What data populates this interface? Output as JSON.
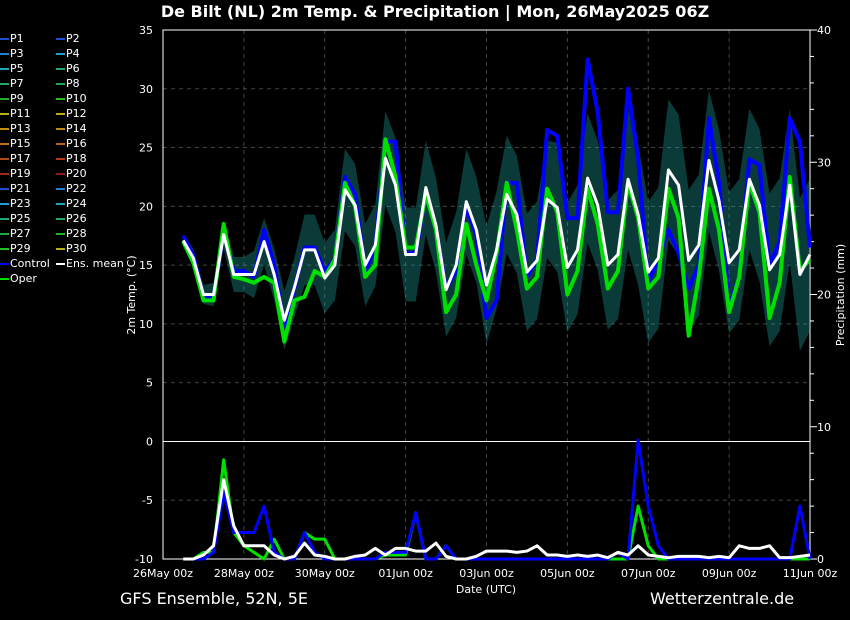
{
  "title": "De Bilt  (NL)  2m Temp. & Precipitation | Mon, 26May2025 06Z",
  "footer": {
    "left": "GFS Ensemble, 52N, 5E",
    "right": "Wetterzentrale.de"
  },
  "legend": [
    {
      "label": "P1",
      "color": "#1f4fd0"
    },
    {
      "label": "P2",
      "color": "#1f4fd0"
    },
    {
      "label": "P3",
      "color": "#1f7fd0"
    },
    {
      "label": "P4",
      "color": "#1f9fd0"
    },
    {
      "label": "P5",
      "color": "#1fa8b8"
    },
    {
      "label": "P6",
      "color": "#1fa880"
    },
    {
      "label": "P7",
      "color": "#1fa860"
    },
    {
      "label": "P8",
      "color": "#1fa850"
    },
    {
      "label": "P9",
      "color": "#20b030"
    },
    {
      "label": "P10",
      "color": "#20c020"
    },
    {
      "label": "P11",
      "color": "#b8b010"
    },
    {
      "label": "P12",
      "color": "#c0a810"
    },
    {
      "label": "P13",
      "color": "#c09010"
    },
    {
      "label": "P14",
      "color": "#c08810"
    },
    {
      "label": "P15",
      "color": "#c07010"
    },
    {
      "label": "P16",
      "color": "#b86010"
    },
    {
      "label": "P17",
      "color": "#b04a18"
    },
    {
      "label": "P18",
      "color": "#b03a18"
    },
    {
      "label": "P19",
      "color": "#a02a18"
    },
    {
      "label": "P20",
      "color": "#901818"
    },
    {
      "label": "P21",
      "color": "#1f4fd0"
    },
    {
      "label": "P22",
      "color": "#1f7fd0"
    },
    {
      "label": "P23",
      "color": "#1f9fd0"
    },
    {
      "label": "P24",
      "color": "#1fa8b8"
    },
    {
      "label": "P25",
      "color": "#1fa880"
    },
    {
      "label": "P26",
      "color": "#1fa860"
    },
    {
      "label": "P27",
      "color": "#1fa840"
    },
    {
      "label": "P28",
      "color": "#20b030"
    },
    {
      "label": "P29",
      "color": "#20c020"
    },
    {
      "label": "P30",
      "color": "#b8b010"
    },
    {
      "label": "Control",
      "color": "#0000ff"
    },
    {
      "label": "Ens. mean",
      "color": "#ffffff"
    },
    {
      "label": "Oper",
      "color": "#00e000"
    }
  ],
  "chart_data": {
    "type": "line",
    "title": "De Bilt  (NL)  2m Temp. & Precipitation | Mon, 26May2025 06Z",
    "xlabel": "Date (UTC)",
    "ylabel": "2m Temp. (°C)",
    "y2label": "Precipitation (mm)",
    "x_start": "26May2025 12Z",
    "x_step_hours": 6,
    "xlim": [
      "26May 00z",
      "11Jun 00z"
    ],
    "xticks": [
      "26May 00z",
      "28May 00z",
      "30May 00z",
      "01Jun 00z",
      "03Jun 00z",
      "05Jun 00z",
      "07Jun 00z",
      "09Jun 00z",
      "11Jun 00z"
    ],
    "ylim": [
      -10,
      35
    ],
    "yticks": [
      "-10",
      "-5",
      "0",
      "5",
      "10",
      "15",
      "20",
      "25",
      "30",
      "35"
    ],
    "y2lim": [
      0,
      40
    ],
    "y2ticks": [
      "0",
      "10",
      "20",
      "30",
      "40"
    ],
    "grid": true,
    "legend_position": "left",
    "temperature": {
      "ens_mean": [
        17.1,
        15.6,
        12.5,
        12.5,
        17.6,
        14.2,
        14.2,
        14.2,
        17.0,
        14.2,
        10.3,
        13.1,
        16.3,
        16.3,
        13.9,
        15.0,
        21.4,
        20.1,
        15.0,
        16.7,
        24.1,
        21.8,
        15.9,
        15.9,
        21.6,
        18.4,
        12.9,
        15.0,
        20.4,
        18.0,
        13.3,
        16.3,
        21.0,
        19.3,
        14.4,
        15.4,
        20.6,
        19.9,
        14.8,
        16.3,
        22.4,
        20.1,
        15.0,
        15.9,
        22.3,
        19.3,
        14.4,
        15.6,
        23.1,
        21.8,
        15.4,
        16.7,
        23.9,
        20.5,
        15.2,
        16.3,
        22.3,
        20.1,
        14.6,
        15.9,
        21.8,
        14.2,
        15.9
      ],
      "control": [
        17.5,
        15.8,
        12.3,
        12.3,
        17.8,
        14.5,
        14.5,
        14.0,
        18.0,
        15.0,
        9.8,
        13.0,
        16.5,
        16.5,
        14.5,
        15.5,
        22.5,
        21.0,
        14.5,
        16.5,
        25.5,
        25.5,
        16.0,
        16.0,
        21.0,
        18.0,
        13.0,
        14.5,
        20.0,
        17.5,
        10.5,
        12.0,
        22.0,
        22.0,
        14.0,
        15.5,
        26.5,
        26.0,
        19.0,
        19.0,
        32.5,
        28.0,
        19.5,
        19.5,
        30.0,
        24.0,
        13.5,
        15.5,
        18.0,
        16.0,
        13.0,
        15.0,
        27.5,
        22.0,
        11.5,
        14.0,
        24.0,
        23.5,
        15.0,
        17.0,
        27.5,
        25.5,
        16.5
      ],
      "oper": [
        17.0,
        15.2,
        12.0,
        12.0,
        18.5,
        14.0,
        13.8,
        13.5,
        14.0,
        13.5,
        8.5,
        12.0,
        12.3,
        14.5,
        14.0,
        15.5,
        22.0,
        20.0,
        14.0,
        15.0,
        25.7,
        22.5,
        16.5,
        16.5,
        21.0,
        18.0,
        11.0,
        12.5,
        18.5,
        15.0,
        12.0,
        16.0,
        22.0,
        18.0,
        13.0,
        14.0,
        21.5,
        19.5,
        12.5,
        14.5,
        21.5,
        18.5,
        13.0,
        14.5,
        22.0,
        19.0,
        13.0,
        14.0,
        21.5,
        19.0,
        9.0,
        14.0,
        21.5,
        18.0,
        11.0,
        14.0,
        22.0,
        19.5,
        10.5,
        13.5,
        22.5,
        14.5,
        15.5
      ],
      "member_spread": [
        0.5,
        0.8,
        0.8,
        1,
        1.2,
        1.5,
        1.5,
        2,
        2,
        2.2,
        2.5,
        2.5,
        3,
        3,
        3,
        3,
        3.5,
        3.5,
        3.5,
        3.5,
        4,
        4,
        4,
        4,
        4,
        4,
        4,
        4.5,
        4.5,
        4.5,
        5,
        5,
        5,
        5,
        5,
        5,
        5,
        5.5,
        5.5,
        5.5,
        5.5,
        5.5,
        5.5,
        5.5,
        6,
        6,
        6,
        6,
        6,
        6,
        6,
        6,
        6,
        6,
        6,
        6,
        6,
        6.5,
        6.5,
        6.5,
        6.5,
        6.5,
        6.5
      ]
    },
    "precipitation": {
      "ens_mean": [
        0,
        0,
        0.3,
        1,
        6,
        2.5,
        1,
        1,
        1,
        0.3,
        0,
        0.2,
        1.2,
        0.3,
        0.2,
        0,
        0,
        0.2,
        0.3,
        0.8,
        0.3,
        0.8,
        0.8,
        0.6,
        0.6,
        1.2,
        0.2,
        0,
        0,
        0.2,
        0.6,
        0.6,
        0.6,
        0.5,
        0.6,
        1,
        0.3,
        0.3,
        0.2,
        0.3,
        0.2,
        0.3,
        0.1,
        0.5,
        0.3,
        1,
        0.3,
        0.2,
        0.1,
        0.2,
        0.2,
        0.2,
        0.1,
        0.2,
        0.1,
        1,
        0.8,
        0.8,
        1,
        0.1,
        0.1,
        0.2,
        0.3
      ],
      "control": [
        0,
        0,
        0,
        0.5,
        5,
        2,
        2,
        2,
        4,
        0.5,
        0,
        0,
        2,
        0.5,
        0,
        0,
        0,
        0,
        0,
        0,
        0.5,
        0.5,
        0.5,
        3.5,
        0,
        0,
        1,
        0,
        0,
        0,
        0,
        0,
        0,
        0,
        0,
        0,
        0,
        0,
        0,
        0,
        0,
        0,
        0,
        0.5,
        0,
        9,
        4,
        1,
        0,
        0,
        0,
        0,
        0,
        0,
        0,
        0,
        0,
        0,
        0,
        0,
        0,
        4,
        0
      ],
      "oper": [
        0,
        0,
        0.5,
        0.5,
        7.5,
        2,
        1,
        0.5,
        0,
        1.5,
        0,
        0,
        2,
        1.5,
        1.5,
        0,
        0,
        0,
        0,
        0,
        0.3,
        0.3,
        0.3,
        3.5,
        0,
        0,
        1,
        0,
        0,
        0,
        0,
        0,
        0,
        0,
        0,
        0,
        0,
        0,
        0,
        0,
        0,
        0,
        0,
        0,
        0,
        4,
        1,
        0,
        0,
        0,
        0,
        0,
        0,
        0,
        0,
        0,
        0,
        0,
        0,
        0,
        0,
        0,
        0
      ]
    },
    "colors": {
      "control": "#0000ff",
      "ens_mean": "#ffffff",
      "oper": "#00e000",
      "spread": "#1fa8a0",
      "grid": "#444444"
    }
  }
}
